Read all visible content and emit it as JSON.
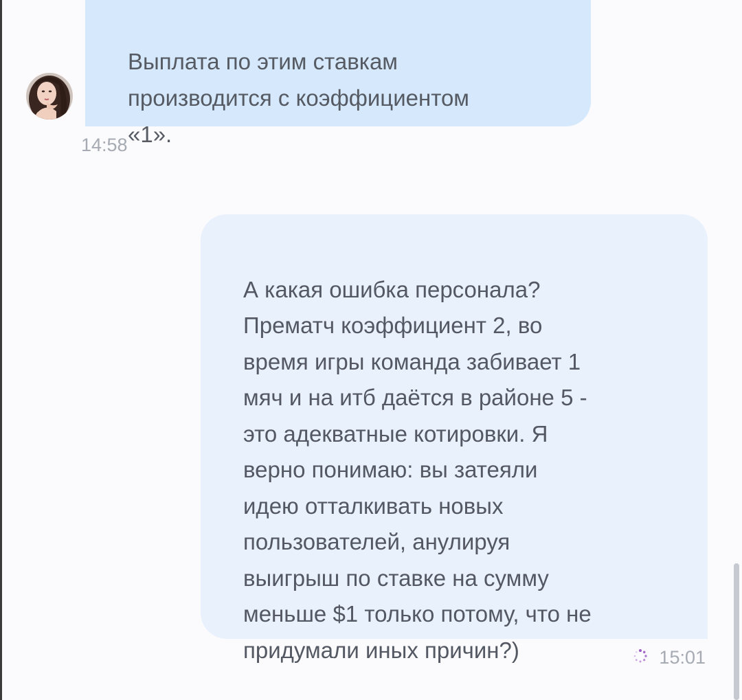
{
  "chat": {
    "incoming": {
      "text": "Выплата по этим ставкам\nпроизводится с коэффициентом\n«1».",
      "time": "14:58"
    },
    "outgoing": {
      "text": "А какая ошибка персонала?\nПрематч коэффициент 2, во\nвремя игры команда забивает 1\nмяч и на итб даётся в районе 5 -\nэто адекватные котировки. Я\nверно понимаю: вы затеяли\nидею отталкивать новых\nпользователей, анулируя\nвыигрыш по ставке на сумму\nменьше $1 только потому, что не\nпридумали иных причин?)",
      "time": "15:01",
      "status_icon": "sending-spinner-icon"
    }
  },
  "colors": {
    "incoming_bubble": "#d6e8fb",
    "outgoing_bubble": "#e9f1fd",
    "spinner": "#9b59c6"
  }
}
